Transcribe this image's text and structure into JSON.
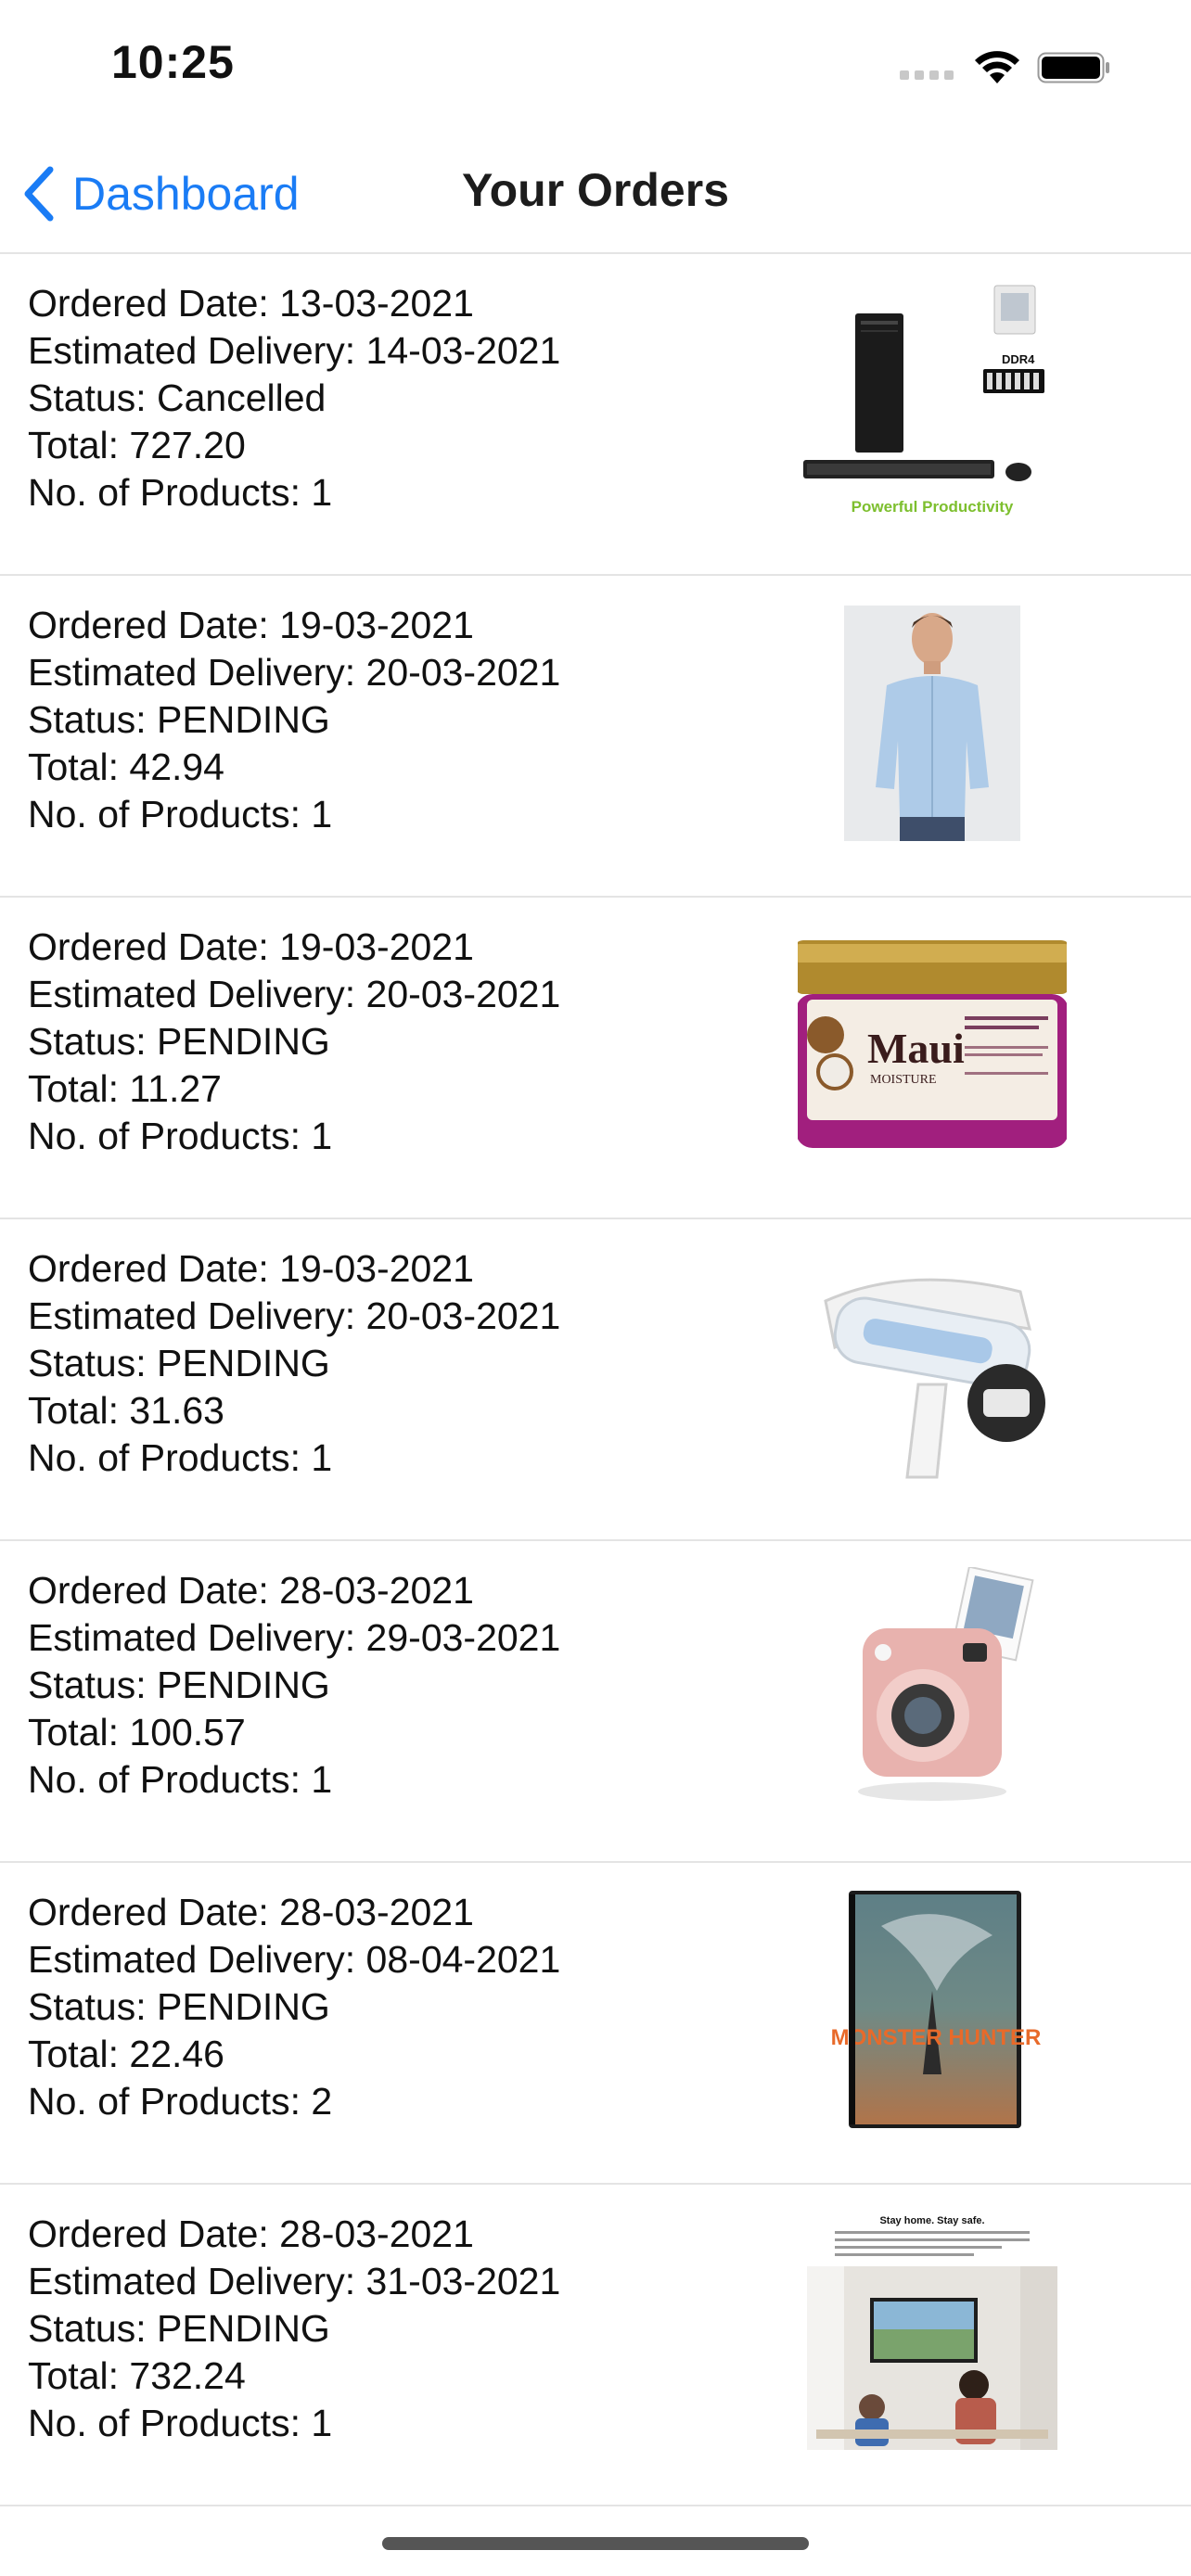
{
  "status_bar": {
    "time": "10:25"
  },
  "nav": {
    "back_label": "Dashboard",
    "title": "Your Orders"
  },
  "orders": [
    {
      "ordered_date": "Ordered Date: 13-03-2021",
      "estimated_delivery": "Estimated Delivery: 14-03-2021",
      "status": "Status: Cancelled",
      "total": "Total: 727.20",
      "num_products": "No. of Products: 1",
      "image_caption": "Powerful Productivity",
      "image_badge": "DDR4",
      "image_icon": "desktop-computer-image"
    },
    {
      "ordered_date": "Ordered Date: 19-03-2021",
      "estimated_delivery": "Estimated Delivery: 20-03-2021",
      "status": "Status: PENDING",
      "total": "Total: 42.94",
      "num_products": "No. of Products: 1",
      "image_icon": "shirt-model-image"
    },
    {
      "ordered_date": "Ordered Date: 19-03-2021",
      "estimated_delivery": "Estimated Delivery: 20-03-2021",
      "status": "Status: PENDING",
      "total": "Total: 11.27",
      "num_products": "No. of Products: 1",
      "image_label": "Maui",
      "image_sublabel": "MOISTURE",
      "image_icon": "hair-mask-jar-image"
    },
    {
      "ordered_date": "Ordered Date: 19-03-2021",
      "estimated_delivery": "Estimated Delivery: 20-03-2021",
      "status": "Status: PENDING",
      "total": "Total: 31.63",
      "num_products": "No. of Products: 1",
      "image_icon": "lint-roller-image"
    },
    {
      "ordered_date": "Ordered Date: 28-03-2021",
      "estimated_delivery": "Estimated Delivery: 29-03-2021",
      "status": "Status: PENDING",
      "total": "Total: 100.57",
      "num_products": "No. of Products: 1",
      "image_icon": "instant-camera-image"
    },
    {
      "ordered_date": "Ordered Date: 28-03-2021",
      "estimated_delivery": "Estimated Delivery: 08-04-2021",
      "status": "Status: PENDING",
      "total": "Total: 22.46",
      "num_products": "No. of Products: 2",
      "image_label": "MONSTER HUNTER",
      "image_icon": "dvd-cover-image"
    },
    {
      "ordered_date": "Ordered Date: 28-03-2021",
      "estimated_delivery": "Estimated Delivery: 31-03-2021",
      "status": "Status: PENDING",
      "total": "Total: 732.24",
      "num_products": "No. of Products: 1",
      "image_label": "Stay home. Stay safe.",
      "image_icon": "tv-flyer-image"
    }
  ],
  "colors": {
    "accent": "#1a7cf5",
    "divider": "#e4e4e4",
    "text": "#111111"
  }
}
